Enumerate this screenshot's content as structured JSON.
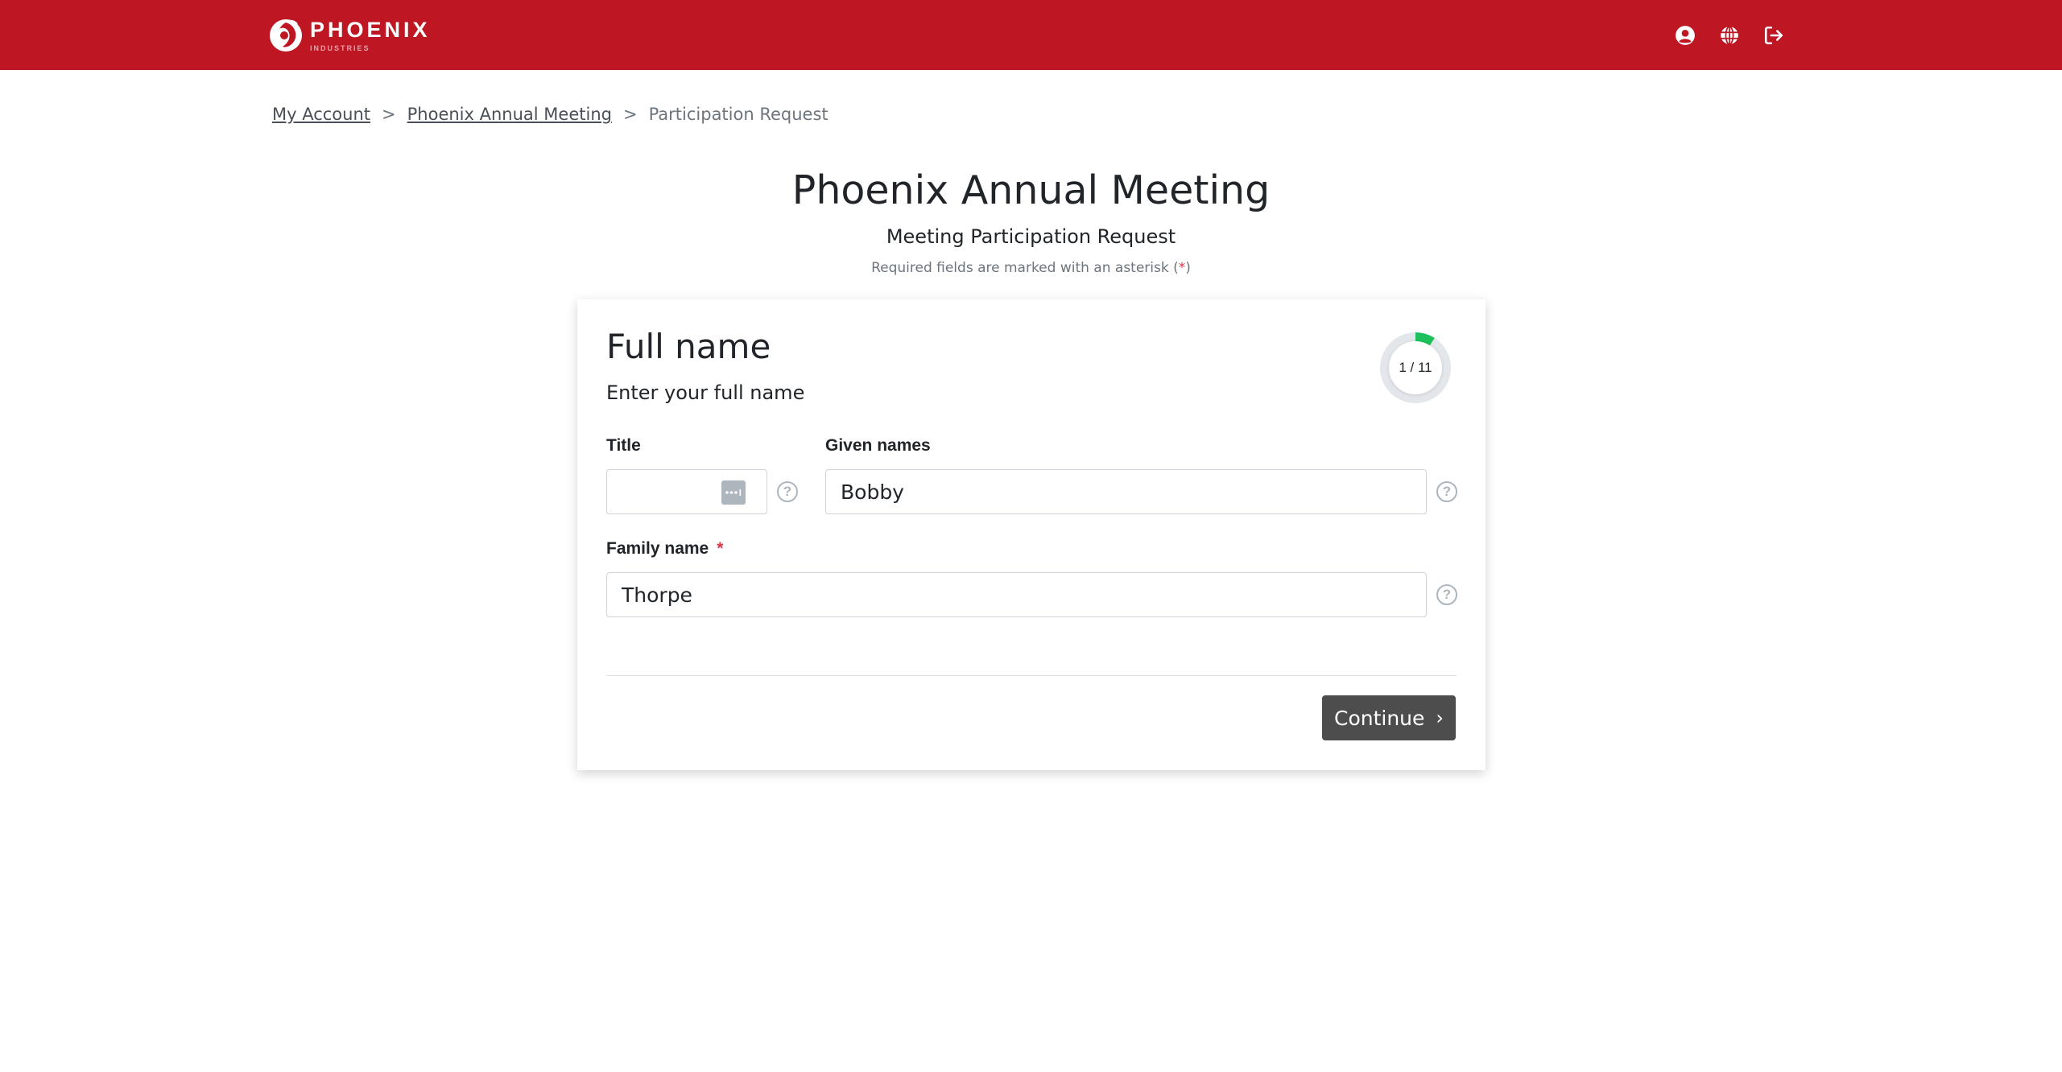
{
  "brand": {
    "name": "PHOENIX",
    "tagline": "INDUSTRIES",
    "color": "#BE1622"
  },
  "header": {
    "icons": [
      {
        "name": "user-account-icon"
      },
      {
        "name": "language-globe-icon"
      },
      {
        "name": "logout-icon"
      }
    ]
  },
  "breadcrumb": {
    "items": [
      {
        "label": "My Account",
        "link": true
      },
      {
        "label": "Phoenix Annual Meeting",
        "link": true
      },
      {
        "label": "Participation Request",
        "link": false
      }
    ],
    "separator": ">"
  },
  "page": {
    "title": "Phoenix Annual Meeting",
    "subtitle": "Meeting Participation Request",
    "required_note_prefix": "Required fields are marked with an asterisk (",
    "required_note_star": "*",
    "required_note_suffix": ")"
  },
  "step": {
    "title": "Full name",
    "description": "Enter your full name",
    "current": 1,
    "total": 11,
    "progress_label": "1 / 11",
    "progress_fraction": 0.0909,
    "progress_color": "#1DC05A",
    "track_color": "#E3E6EA"
  },
  "form": {
    "title_field": {
      "label": "Title",
      "value": "",
      "required": false
    },
    "given_names": {
      "label": "Given names",
      "value": "Bobby",
      "required": false
    },
    "family_name": {
      "label": "Family name",
      "value": "Thorpe",
      "required": true,
      "required_mark": "*"
    },
    "help_glyph": "?"
  },
  "actions": {
    "continue_label": "Continue",
    "continue_chevron": "›"
  }
}
